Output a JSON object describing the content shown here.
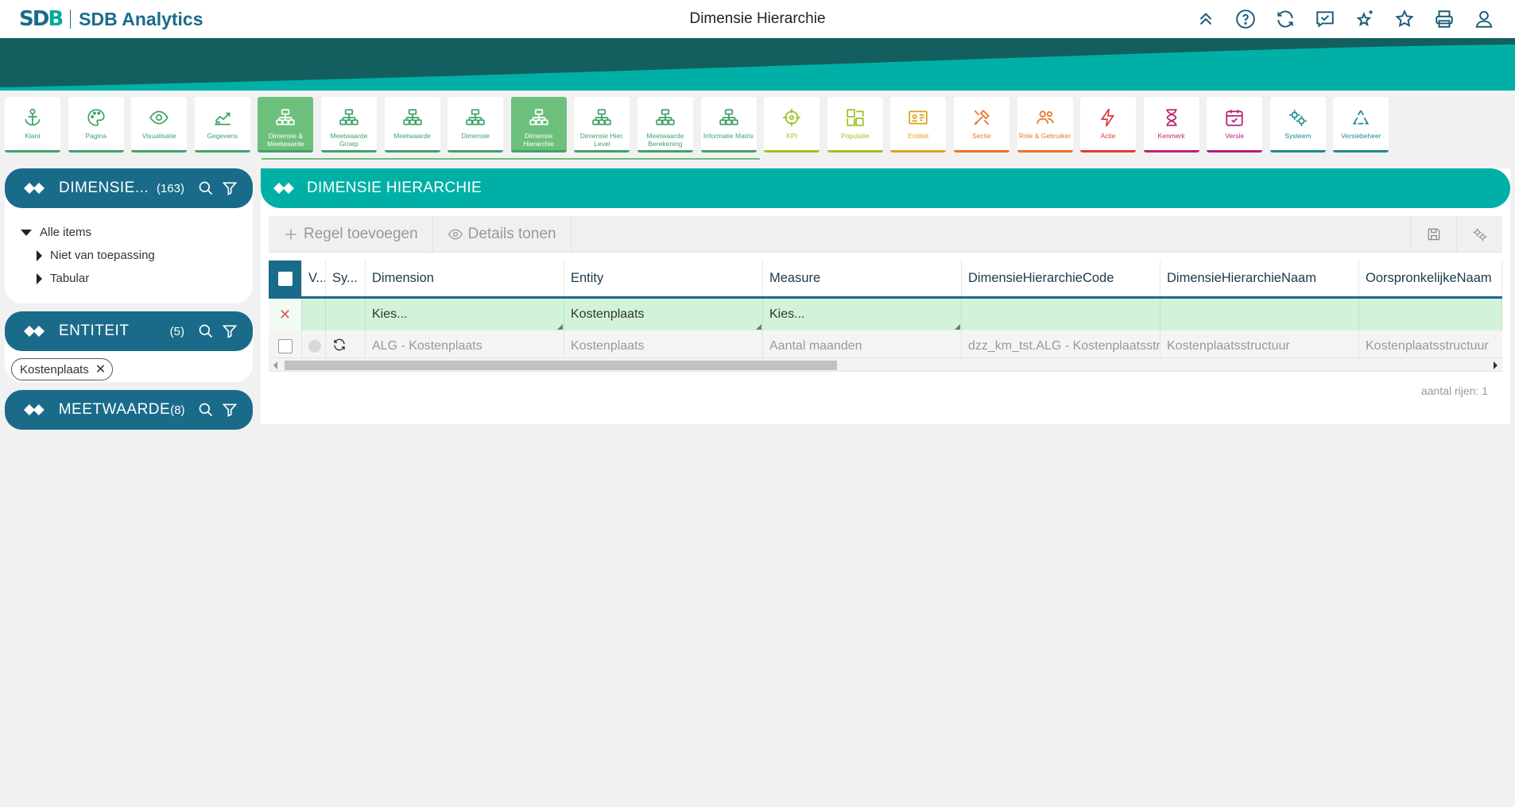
{
  "header": {
    "brand": "SDB Analytics",
    "logo": "SDB",
    "page_title": "Dimensie Hierarchie",
    "icons": [
      "chevrons-up-icon",
      "help-icon",
      "refresh-icon",
      "checklist-icon",
      "sparkle-star-icon",
      "star-icon",
      "print-icon",
      "user-icon"
    ]
  },
  "tiles": [
    {
      "label": "Klant",
      "color": "#3fa26a",
      "icon": "anchor-icon",
      "active": false
    },
    {
      "label": "Pagina",
      "color": "#3fa26a",
      "icon": "palette-icon",
      "active": false
    },
    {
      "label": "Visualisatie",
      "color": "#3fa26a",
      "icon": "eye-icon",
      "active": false
    },
    {
      "label": "Gegevens",
      "color": "#3fa26a",
      "icon": "chart-icon",
      "active": false
    },
    {
      "label": "Dimensie & Meetwaarde",
      "color": "#3fa26a",
      "icon": "hierarchy-icon",
      "active": true
    },
    {
      "label": "Meetwaarde Groep",
      "color": "#3fa26a",
      "icon": "hierarchy-icon",
      "active": false
    },
    {
      "label": "Meetwaarde",
      "color": "#3fa26a",
      "icon": "hierarchy-icon",
      "active": false
    },
    {
      "label": "Dimensie",
      "color": "#3fa26a",
      "icon": "hierarchy-icon",
      "active": false
    },
    {
      "label": "Dimensie Hierarchie",
      "color": "#3fa26a",
      "icon": "hierarchy-icon",
      "active": true
    },
    {
      "label": "Dimensie Hier. Level",
      "color": "#3fa26a",
      "icon": "hierarchy-icon",
      "active": false
    },
    {
      "label": "Meetwaarde Berekening",
      "color": "#3fa26a",
      "icon": "hierarchy-icon",
      "active": false
    },
    {
      "label": "Informatie Matrix",
      "color": "#3fa26a",
      "icon": "hierarchy-icon",
      "active": false
    },
    {
      "label": "KPI",
      "color": "#9cc21f",
      "icon": "target-icon",
      "active": false
    },
    {
      "label": "Populatie",
      "color": "#9cc21f",
      "icon": "puzzle-icon",
      "active": false
    },
    {
      "label": "Entiteit",
      "color": "#e0a020",
      "icon": "id-card-icon",
      "active": false
    },
    {
      "label": "Sectie",
      "color": "#e8742a",
      "icon": "tools-icon",
      "active": false
    },
    {
      "label": "Role & Gebruiker",
      "color": "#e8742a",
      "icon": "users-icon",
      "active": false
    },
    {
      "label": "Actie",
      "color": "#e03a3a",
      "icon": "lightning-icon",
      "active": false
    },
    {
      "label": "Kenmerk",
      "color": "#c0226a",
      "icon": "hourglass-icon",
      "active": false
    },
    {
      "label": "Versie",
      "color": "#b21e7a",
      "icon": "calendar-icon",
      "active": false
    },
    {
      "label": "Systeem",
      "color": "#1f8a8a",
      "icon": "gears-icon",
      "active": false
    },
    {
      "label": "Versiebeheer",
      "color": "#1f8a8a",
      "icon": "recycle-icon",
      "active": false
    }
  ],
  "panels": {
    "dimensie": {
      "title": "DIMENSIE...",
      "count": "(163)",
      "tree": {
        "root": "Alle items",
        "children": [
          "Niet van toepassing",
          "Tabular"
        ]
      }
    },
    "entiteit": {
      "title": "ENTITEIT",
      "count": "(5)",
      "chip": "Kostenplaats"
    },
    "meetwaarde": {
      "title": "MEETWAARDE",
      "count": "(8)"
    }
  },
  "main": {
    "title": "DIMENSIE HIERARCHIE",
    "toolbar": {
      "add_row": "Regel toevoegen",
      "show_details": "Details tonen"
    },
    "columns": [
      "V...",
      "Sy...",
      "Dimension",
      "Entity",
      "Measure",
      "DimensieHierarchieCode",
      "DimensieHierarchieNaam",
      "OorspronkelijkeNaam"
    ],
    "new_row": {
      "dimension": "Kies...",
      "entity": "Kostenplaats",
      "measure": "Kies...",
      "code": "",
      "naam": "",
      "oorspronkelijk": ""
    },
    "rows": [
      {
        "dimension": "ALG - Kostenplaats",
        "entity": "Kostenplaats",
        "measure": "Aantal maanden",
        "code": "dzz_km_tst.ALG - Kostenplaatsstructuur",
        "naam": "Kostenplaatsstructuur",
        "oorspronkelijk": "Kostenplaatsstructuur"
      }
    ],
    "row_count": "aantal rijen: 1"
  },
  "colors": {
    "teal": "#00b0a6",
    "navy": "#1a6b8a",
    "active_green": "#6cc07c"
  }
}
